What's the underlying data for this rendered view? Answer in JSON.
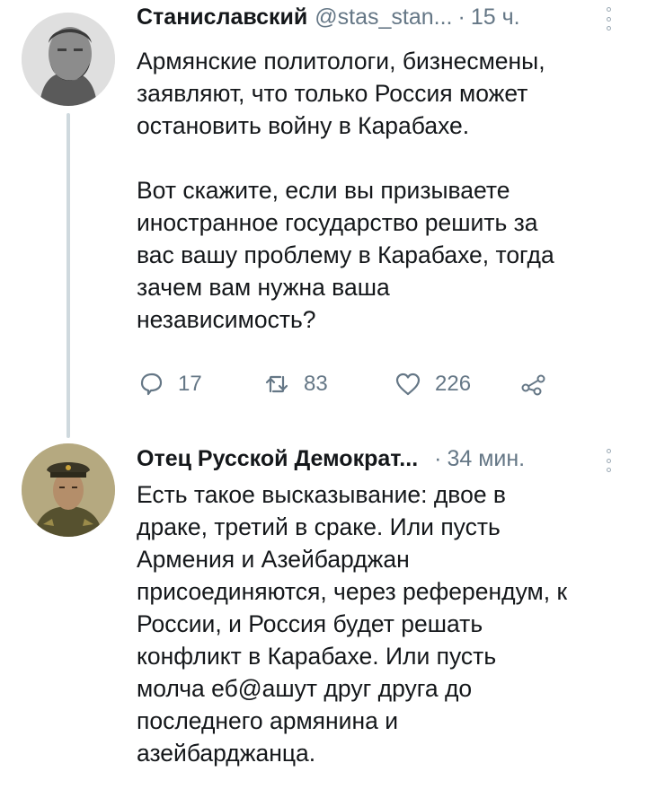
{
  "tweets": [
    {
      "name": "Станиславский",
      "handle": "@stas_stan...",
      "dot": "·",
      "time": "15 ч.",
      "text": "Армянские политологи, бизнесмены,\nзаявляют, что только Россия может\nостановить войну в Карабахе.\n\nВот скажите, если вы призываете\nиностранное государство решить за\nвас вашу проблему в Карабахе, тогда\nзачем вам нужна ваша\nнезависимость?",
      "replies": "17",
      "retweets": "83",
      "likes": "226"
    },
    {
      "name": "Отец Русской Демократ...",
      "dot": "·",
      "time": "34 мин.",
      "text": "Есть такое высказывание: двое в\nдраке, третий в сраке. Или пусть\nАрмения и Азейбарджан\nприсоединяются, через референдум, к\nРоссии, и Россия будет решать\nконфликт в Карабахе. Или пусть\nмолча еб@ашут друг друга до\nпоследнего армянина и\nазейбарджанца."
    }
  ],
  "icons": {
    "reply": "speech-bubble",
    "retweet": "retweet-arrows",
    "like": "heart-outline",
    "share": "share-nodes",
    "more": "vertical-dots"
  },
  "colors": {
    "text": "#14171a",
    "muted": "#657786",
    "thread_line": "#cfd9de"
  }
}
